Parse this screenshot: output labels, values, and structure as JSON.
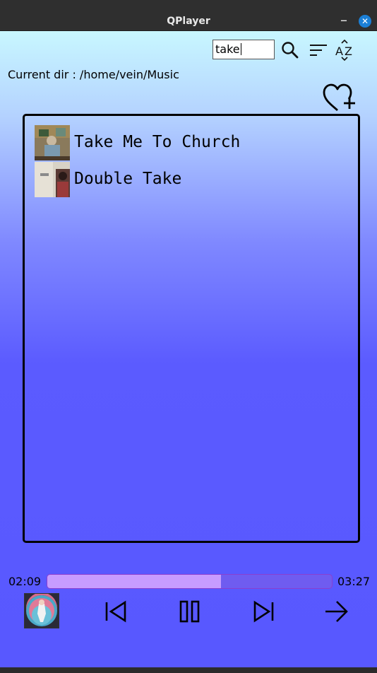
{
  "window": {
    "title": "QPlayer"
  },
  "search": {
    "value": "take"
  },
  "current_dir": {
    "text": "Current dir : /home/vein/Music"
  },
  "icons": {
    "search": "search-icon",
    "sort": "sort-icon",
    "az": "az-sort-icon",
    "favorite_add": "heart-plus-icon",
    "previous": "skip-previous-icon",
    "pause": "pause-icon",
    "next": "skip-next-icon",
    "forward": "arrow-right-icon",
    "minimize": "minimize-icon",
    "close": "close-icon"
  },
  "tracks": [
    {
      "title": "Take Me To Church"
    },
    {
      "title": "Double Take"
    }
  ],
  "player": {
    "elapsed": "02:09",
    "total": "03:27",
    "progress": 0.61
  },
  "colors": {
    "gradient_top": "#c8f7ff",
    "gradient_bottom": "#5858ff",
    "progress_fill": "#c79cff",
    "progress_track": "#6f5cf0",
    "close_button": "#1b7fd6"
  }
}
